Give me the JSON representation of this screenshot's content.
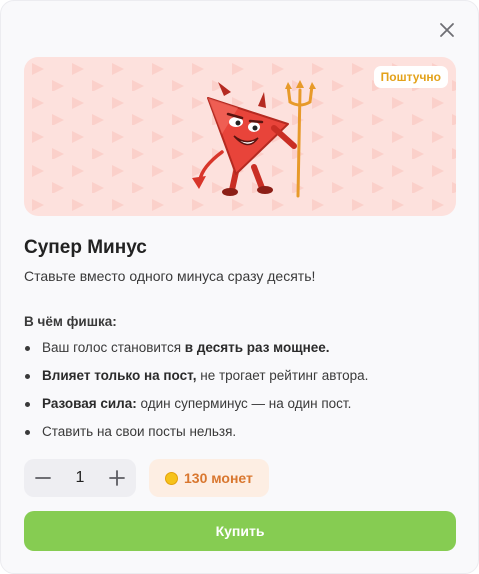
{
  "modal": {
    "badge": "Поштучно",
    "title": "Супер Минус",
    "subtitle": "Ставьте вместо одного минуса сразу десять!",
    "features_heading": "В чём фишка:",
    "features": [
      {
        "plain_before": "Ваш голос становится ",
        "bold": "в десять раз мощнее.",
        "plain_after": ""
      },
      {
        "plain_before": "",
        "bold": "Влияет только на пост,",
        "plain_after": " не трогает рейтинг автора."
      },
      {
        "plain_before": "",
        "bold": "Разовая сила:",
        "plain_after": " один суперминус — на один пост."
      },
      {
        "plain_before": "Ставить на свои посты нельзя.",
        "bold": "",
        "plain_after": ""
      }
    ],
    "quantity": "1",
    "price": "130 монет",
    "buy_label": "Купить",
    "icons": {
      "close": "close-icon",
      "minus": "minus-icon",
      "plus": "plus-icon",
      "coin": "coin-icon",
      "mascot": "devil-minus-mascot"
    },
    "colors": {
      "banner_bg": "#fde1dd",
      "badge_text": "#e3a21a",
      "buy_button": "#86cc52",
      "price_text": "#d9772f",
      "price_bg": "#fdeee3"
    }
  }
}
